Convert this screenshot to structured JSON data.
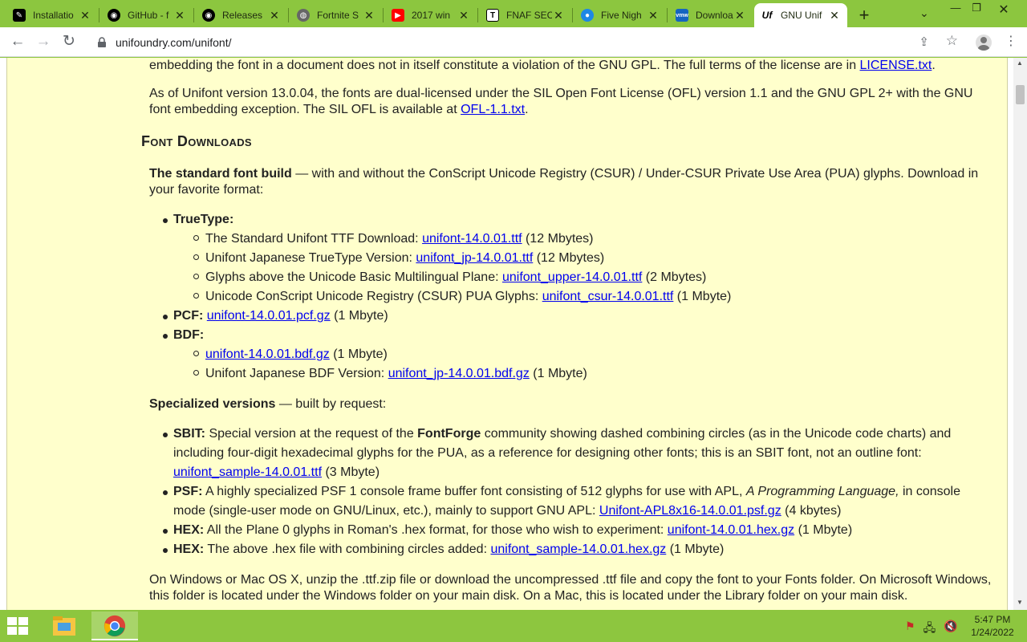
{
  "tabs": [
    {
      "title": "Installatio",
      "icon": "notebook-icon",
      "color": "#000000"
    },
    {
      "title": "GitHub - f",
      "icon": "github-icon",
      "color": "#000000"
    },
    {
      "title": "Releases",
      "icon": "github-icon",
      "color": "#000000"
    },
    {
      "title": "Fortnite S",
      "icon": "globe-icon",
      "color": "#555555"
    },
    {
      "title": "2017 win",
      "icon": "youtube-icon",
      "color": "#ff0000"
    },
    {
      "title": "FNAF SEC",
      "icon": "t-icon",
      "color": "#000000"
    },
    {
      "title": "Five Nigh",
      "icon": "eye-icon",
      "color": "#1e88e5"
    },
    {
      "title": "Downloa",
      "icon": "vmw-icon",
      "color": "#1565c0"
    },
    {
      "title": "GNU Unif",
      "icon": "uf-icon",
      "color": "#000000"
    }
  ],
  "toolbar": {
    "url": "unifoundry.com/unifont/"
  },
  "content": {
    "license_line_start": "embedding the font in a document does not in itself constitute a violation of the GNU GPL. The full terms of the license are in ",
    "license_link": "LICENSE.txt",
    "license_line_end": ".",
    "ofl_line1": "As of Unifont version 13.0.04, the fonts are dual-licensed under the SIL Open Font License (OFL) version 1.1 and the GNU GPL 2+ with the GNU",
    "ofl_line2": "font embedding exception. The SIL OFL is available at ",
    "ofl_link": "OFL-1.1.txt",
    "ofl_end": ".",
    "heading": "Font Downloads",
    "std_bold": "The standard font build",
    "std_text1": " — with and without the ConScript Unicode Registry (CSUR) / Under-CSUR Private Use Area (PUA) glyphs. Download in",
    "std_text2": "your favorite format:",
    "truetype_label": "TrueType:",
    "tt_items": [
      {
        "text": "The Standard Unifont TTF Download: ",
        "link": "unifont-14.0.01.ttf",
        "size": " (12 Mbytes)"
      },
      {
        "text": "Unifont Japanese TrueType Version: ",
        "link": "unifont_jp-14.0.01.ttf",
        "size": " (12 Mbytes)"
      },
      {
        "text": "Glyphs above the Unicode Basic Multilingual Plane: ",
        "link": "unifont_upper-14.0.01.ttf",
        "size": " (2 Mbytes)"
      },
      {
        "text": "Unicode ConScript Unicode Registry (CSUR) PUA Glyphs: ",
        "link": "unifont_csur-14.0.01.ttf",
        "size": " (1 Mbyte)"
      }
    ],
    "pcf_label": "PCF:",
    "pcf_link": "unifont-14.0.01.pcf.gz",
    "pcf_size": " (1 Mbyte)",
    "bdf_label": "BDF:",
    "bdf_items": [
      {
        "text": "",
        "link": "unifont-14.0.01.bdf.gz",
        "size": " (1 Mbyte)"
      },
      {
        "text": "Unifont Japanese BDF Version: ",
        "link": "unifont_jp-14.0.01.bdf.gz",
        "size": " (1 Mbyte)"
      }
    ],
    "spec_bold": "Specialized versions",
    "spec_text": " — built by request:",
    "sbit_label": "SBIT:",
    "sbit_text1a": " Special version at the request of the ",
    "sbit_bold": "FontForge",
    "sbit_text1b": " community showing dashed combining circles (as in the Unicode code charts) and",
    "sbit_text2": "including four-digit hexadecimal glyphs for the PUA, as a reference for designing other fonts; this is an SBIT font, not an outline font:",
    "sbit_link": "unifont_sample-14.0.01.ttf",
    "sbit_size": " (3 Mbyte)",
    "psf_label": "PSF:",
    "psf_text1a": " A highly specialized PSF 1 console frame buffer font consisting of 512 glyphs for use with APL, ",
    "psf_italic": "A Programming Language,",
    "psf_text1b": " in console",
    "psf_text2": "mode (single-user mode on GNU/Linux, etc.), mainly to support GNU APL: ",
    "psf_link": "Unifont-APL8x16-14.0.01.psf.gz",
    "psf_size": " (4 kbytes)",
    "hex1_label": "HEX:",
    "hex1_text": " All the Plane 0 glyphs in Roman's .hex format, for those who wish to experiment: ",
    "hex1_link": "unifont-14.0.01.hex.gz",
    "hex1_size": " (1 Mbyte)",
    "hex2_label": "HEX:",
    "hex2_text": " The above .hex file with combining circles added: ",
    "hex2_link": "unifont_sample-14.0.01.hex.gz",
    "hex2_size": " (1 Mbyte)",
    "win_line1": "On Windows or Mac OS X, unzip the .ttf.zip file or download the uncompressed .ttf file and copy the font to your Fonts folder. On Microsoft Windows,",
    "win_line2": "this folder is located under the Windows folder on your main disk. On a Mac, this is located under the Library folder on your main disk."
  },
  "taskbar": {
    "time": "5:47 PM",
    "date": "1/24/2022"
  },
  "colors": {
    "accent": "#8dc63f",
    "page_bg": "#ffffcc",
    "link": "#0000ee"
  }
}
